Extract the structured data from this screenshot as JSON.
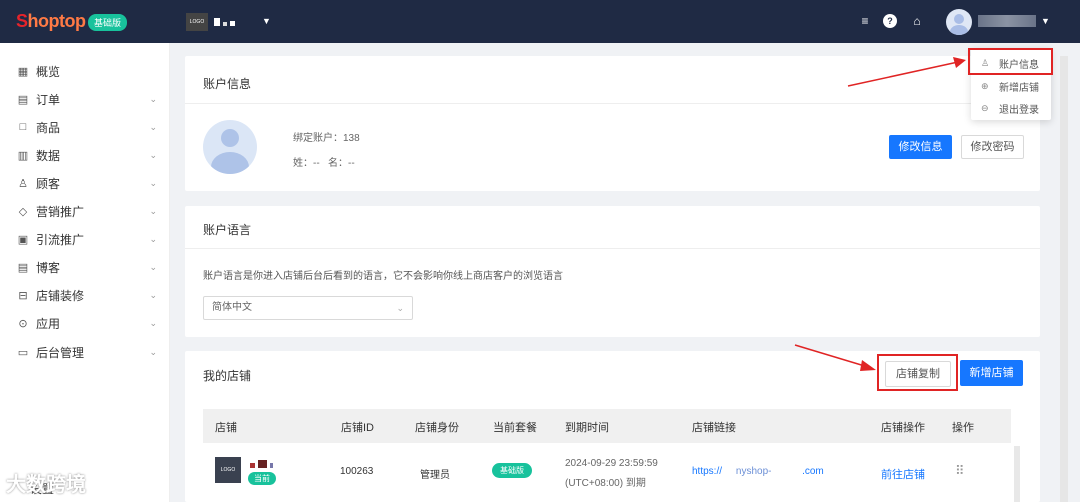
{
  "header": {
    "logo_s": "S",
    "logo_rest": "hoptop",
    "plan_badge": "基础版",
    "shop_logo": "LOGO"
  },
  "sidebar": {
    "items": [
      {
        "label": "概览",
        "icon": "grid-icon",
        "glyph": "▦"
      },
      {
        "label": "订单",
        "icon": "order-icon",
        "glyph": "▤"
      },
      {
        "label": "商品",
        "icon": "product-icon",
        "glyph": "□"
      },
      {
        "label": "数据",
        "icon": "chart-icon",
        "glyph": "▥"
      },
      {
        "label": "顾客",
        "icon": "user-icon",
        "glyph": "♙"
      },
      {
        "label": "营销推广",
        "icon": "tag-icon",
        "glyph": "◇"
      },
      {
        "label": "引流推广",
        "icon": "doc-icon",
        "glyph": "▣"
      },
      {
        "label": "博客",
        "icon": "blog-icon",
        "glyph": "▤"
      },
      {
        "label": "店铺装修",
        "icon": "store-icon",
        "glyph": "⊟"
      },
      {
        "label": "应用",
        "icon": "app-icon",
        "glyph": "⊙"
      },
      {
        "label": "后台管理",
        "icon": "folder-icon",
        "glyph": "▭"
      }
    ],
    "settings": "设置",
    "watermark": "大数跨境"
  },
  "account": {
    "title": "账户信息",
    "bound_label": "绑定账户：",
    "bound_value": "138",
    "surname_label": "姓：--",
    "name_label": "名：--",
    "edit_info": "修改信息",
    "edit_password": "修改密码"
  },
  "language": {
    "title": "账户语言",
    "description": "账户语言是你进入店铺后台后看到的语言，它不会影响你线上商店客户的浏览语言",
    "selected": "简体中文"
  },
  "shops": {
    "title": "我的店铺",
    "copy_button": "店铺复制",
    "add_button": "新增店铺",
    "columns": [
      "店铺",
      "店铺ID",
      "店铺身份",
      "当前套餐",
      "到期时间",
      "店铺链接",
      "店铺操作",
      "操作"
    ],
    "rows": [
      {
        "logo": "LOGO",
        "current_tag": "当前",
        "id": "100263",
        "role": "管理员",
        "plan": "基础版",
        "expire_line1": "2024-09-29 23:59:59",
        "expire_line2": "(UTC+08:00) 到期",
        "link_prefix": "https://",
        "link_mid": "nyshop-",
        "link_suffix": ".com",
        "action": "前往店铺",
        "more": "⠿"
      }
    ]
  },
  "dropdown": {
    "items": [
      {
        "label": "账户信息",
        "icon": "user-icon",
        "glyph": "♙"
      },
      {
        "label": "新增店铺",
        "icon": "plus-circle-icon",
        "glyph": "⊕"
      },
      {
        "label": "退出登录",
        "icon": "logout-icon",
        "glyph": "⊖"
      }
    ]
  },
  "colors": {
    "primary": "#1677ff",
    "topbar": "#1f2a44",
    "green": "#18c29c",
    "annotation": "#e02424"
  }
}
